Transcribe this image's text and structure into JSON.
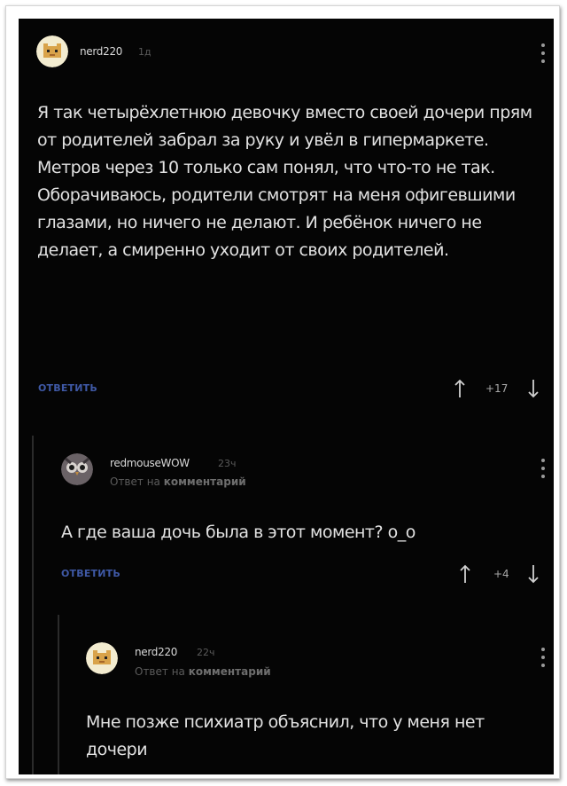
{
  "comments": [
    {
      "username": "nerd220",
      "time": "1д",
      "text": "Я так четырёхлетнюю девочку вместо своей дочери прям от родителей забрал за руку и увёл в гипермаркете. Метров через 10 только сам понял, что что-то не так. Оборачиваюсь, родители смотрят на меня офигевшими глазами, но ничего не делают. И ребёнок ничего не делает, а смиренно уходит от своих родителей.",
      "reply_label": "ОТВЕТИТЬ",
      "score": "+17",
      "avatar_icon": "pixel-cat-avatar-icon"
    },
    {
      "username": "redmouseWOW",
      "time": "23ч",
      "reply_to_prefix": "Ответ на",
      "reply_to_target": "комментарий",
      "text": "А где ваша дочь была в этот момент? о_о",
      "reply_label": "ОТВЕТИТЬ",
      "score": "+4",
      "avatar_icon": "owl-avatar-icon"
    },
    {
      "username": "nerd220",
      "time": "22ч",
      "reply_to_prefix": "Ответ на",
      "reply_to_target": "комментарий",
      "text": "Мне позже психиатр объяснил, что у меня нет дочери",
      "avatar_icon": "pixel-cat-avatar-icon"
    }
  ],
  "colors": {
    "background": "#050505",
    "text": "#e2e2e2",
    "reply_link": "#3f59a6",
    "muted": "#5a5a5a"
  },
  "icons": {
    "menu": "kebab-menu-icon",
    "upvote": "arrow-up-icon",
    "downvote": "arrow-down-icon"
  }
}
